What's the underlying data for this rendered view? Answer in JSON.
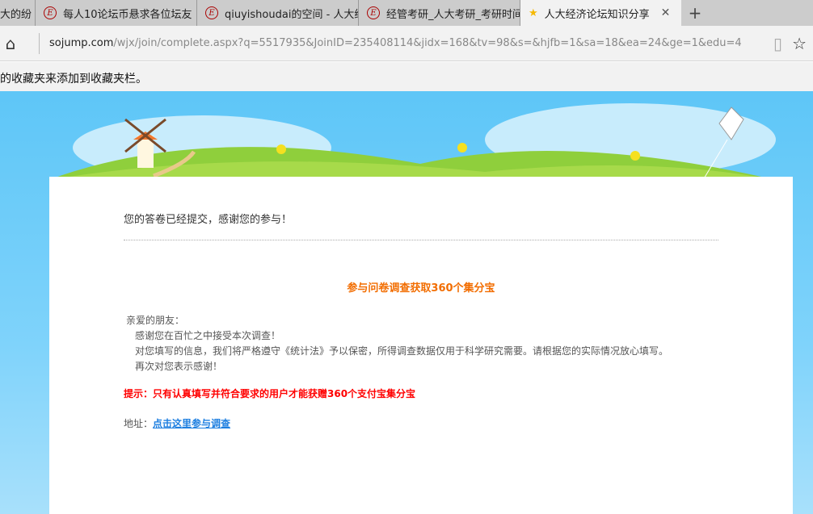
{
  "tabs": [
    {
      "label": "大的纷",
      "icon": "none"
    },
    {
      "label": "每人10论坛币悬求各位坛友",
      "icon": "forum-favicon"
    },
    {
      "label": "qiuyishoudai的空间 - 人大经",
      "icon": "forum-favicon"
    },
    {
      "label": "经管考研_人大考研_考研时间",
      "icon": "forum-favicon"
    },
    {
      "label": "人大经济论坛知识分享",
      "icon": "star-favicon",
      "active": true
    }
  ],
  "address": {
    "domain": "sojump.com",
    "path": "/wjx/join/complete.aspx?q=5517935&JoinID=235408114&jidx=168&tv=98&s=&hjfb=1&sa=18&ea=24&ge=1&edu=4"
  },
  "favorites_hint": "的收藏夹来添加到收藏夹栏。",
  "page": {
    "thanks": "您的答卷已经提交，感谢您的参与！",
    "title": "参与问卷调查获取360个集分宝",
    "lines": [
      "亲爱的朋友：",
      "感谢您在百忙之中接受本次调查！",
      "对您填写的信息，我们将严格遵守《统计法》予以保密，所得调查数据仅用于科学研究需要。请根据您的实际情况放心填写。",
      "再次对您表示感谢！"
    ],
    "tip": "提示：只有认真填写并符合要求的用户才能获赠360个支付宝集分宝",
    "address_label": "地址：",
    "address_link": "点击这里参与调查"
  }
}
